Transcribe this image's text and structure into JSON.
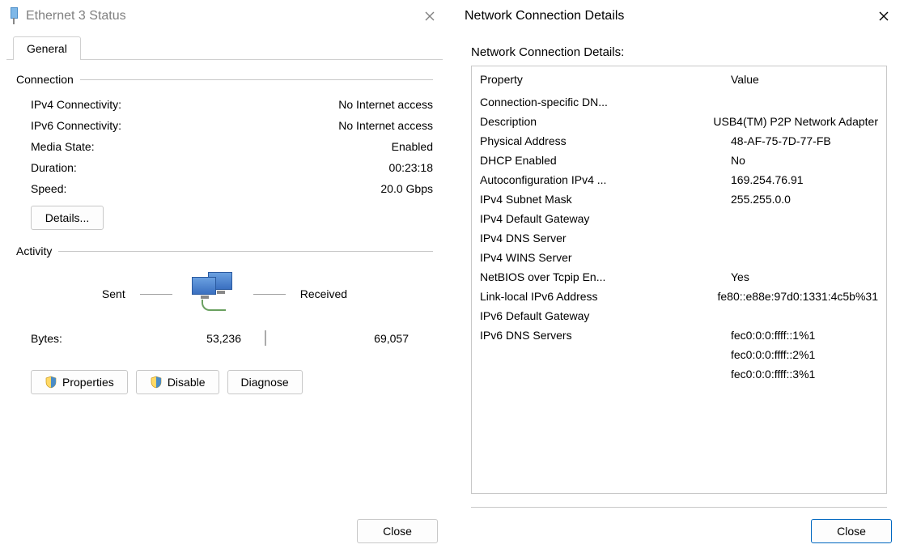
{
  "status": {
    "title": "Ethernet 3 Status",
    "tab": "General",
    "connection": {
      "header": "Connection",
      "ipv4_label": "IPv4 Connectivity:",
      "ipv4_value": "No Internet access",
      "ipv6_label": "IPv6 Connectivity:",
      "ipv6_value": "No Internet access",
      "media_label": "Media State:",
      "media_value": "Enabled",
      "duration_label": "Duration:",
      "duration_value": "00:23:18",
      "speed_label": "Speed:",
      "speed_value": "20.0 Gbps",
      "details_btn": "Details..."
    },
    "activity": {
      "header": "Activity",
      "sent_label": "Sent",
      "received_label": "Received",
      "bytes_label": "Bytes:",
      "bytes_sent": "53,236",
      "bytes_received": "69,057"
    },
    "buttons": {
      "properties": "Properties",
      "disable": "Disable",
      "diagnose": "Diagnose",
      "close": "Close"
    }
  },
  "details": {
    "title": "Network Connection Details",
    "subtitle": "Network Connection Details:",
    "col_property": "Property",
    "col_value": "Value",
    "rows": [
      {
        "p": "Connection-specific DN...",
        "v": ""
      },
      {
        "p": "Description",
        "v": "USB4(TM) P2P Network Adapter"
      },
      {
        "p": "Physical Address",
        "v": "48-AF-75-7D-77-FB"
      },
      {
        "p": "DHCP Enabled",
        "v": "No"
      },
      {
        "p": "Autoconfiguration IPv4 ...",
        "v": "169.254.76.91"
      },
      {
        "p": "IPv4 Subnet Mask",
        "v": "255.255.0.0"
      },
      {
        "p": "IPv4 Default Gateway",
        "v": ""
      },
      {
        "p": "IPv4 DNS Server",
        "v": ""
      },
      {
        "p": "IPv4 WINS Server",
        "v": ""
      },
      {
        "p": "NetBIOS over Tcpip En...",
        "v": "Yes"
      },
      {
        "p": "Link-local IPv6 Address",
        "v": "fe80::e88e:97d0:1331:4c5b%31"
      },
      {
        "p": "IPv6 Default Gateway",
        "v": ""
      },
      {
        "p": "IPv6 DNS Servers",
        "v": "fec0:0:0:ffff::1%1"
      },
      {
        "p": "",
        "v": "fec0:0:0:ffff::2%1"
      },
      {
        "p": "",
        "v": "fec0:0:0:ffff::3%1"
      }
    ],
    "close_btn": "Close"
  }
}
